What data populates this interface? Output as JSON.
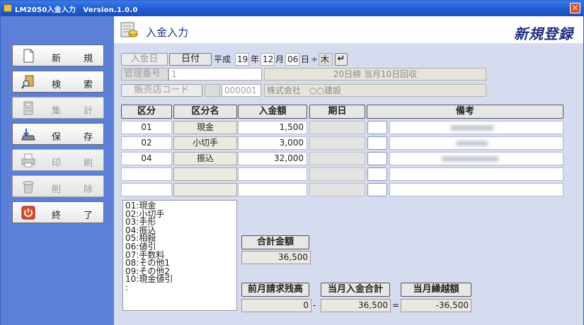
{
  "window": {
    "title": "LM2050入金入力　Version.1.0.0",
    "close_glyph": "✕"
  },
  "header": {
    "screen_title": "入金入力",
    "mode": "新規登録"
  },
  "sidebar": [
    {
      "c1": "新",
      "c2": "規",
      "icon": "new-document-icon",
      "enabled": true
    },
    {
      "c1": "検",
      "c2": "索",
      "icon": "search-icon",
      "enabled": true
    },
    {
      "c1": "集",
      "c2": "計",
      "icon": "calculator-icon",
      "enabled": false
    },
    {
      "c1": "保",
      "c2": "存",
      "icon": "save-icon",
      "enabled": true
    },
    {
      "c1": "印",
      "c2": "刷",
      "icon": "printer-icon",
      "enabled": false
    },
    {
      "c1": "削",
      "c2": "除",
      "icon": "trash-icon",
      "enabled": false
    },
    {
      "c1": "終",
      "c2": "了",
      "icon": "power-icon",
      "enabled": true
    }
  ],
  "form": {
    "date_label": "入金日",
    "date_btn": "日付",
    "era": "平成",
    "year": "19",
    "year_suffix": "年",
    "month": "12",
    "month_suffix": "月",
    "day": "06",
    "day_suffix": "日",
    "spin": "÷",
    "weekday": "木",
    "enter_glyph": "↵",
    "mgmt_label": "管理番号",
    "mgmt_value": "1",
    "closing_info": "20日締 当月10日回収",
    "store_label": "販売店コード",
    "store_code": "000001",
    "store_name": "株式会社　○○建設"
  },
  "table": {
    "headers": [
      "区分",
      "区分名",
      "入金額",
      "期日",
      "備考"
    ],
    "rows": [
      {
        "code": "01",
        "name": "現金",
        "amount": "1,500"
      },
      {
        "code": "02",
        "name": "小切手",
        "amount": "3,000"
      },
      {
        "code": "04",
        "name": "振込",
        "amount": "32,000"
      },
      {
        "code": "",
        "name": "",
        "amount": ""
      },
      {
        "code": "",
        "name": "",
        "amount": ""
      }
    ]
  },
  "codes": [
    "01:現金",
    "02:小切手",
    "03:手形",
    "04:振込",
    "05:相殺",
    "06:値引",
    "07:手数料",
    "08:その他1",
    "09:その他2",
    "10:現金値引",
    ":"
  ],
  "totals": {
    "sum_label": "合計金額",
    "sum_value": "36,500",
    "prev_label": "前月請求残高",
    "prev_value": "0",
    "minus": "-",
    "month_label": "当月入金合計",
    "month_value": "36,500",
    "equals": "=",
    "carry_label": "当月繰越額",
    "carry_value": "-36,500"
  }
}
